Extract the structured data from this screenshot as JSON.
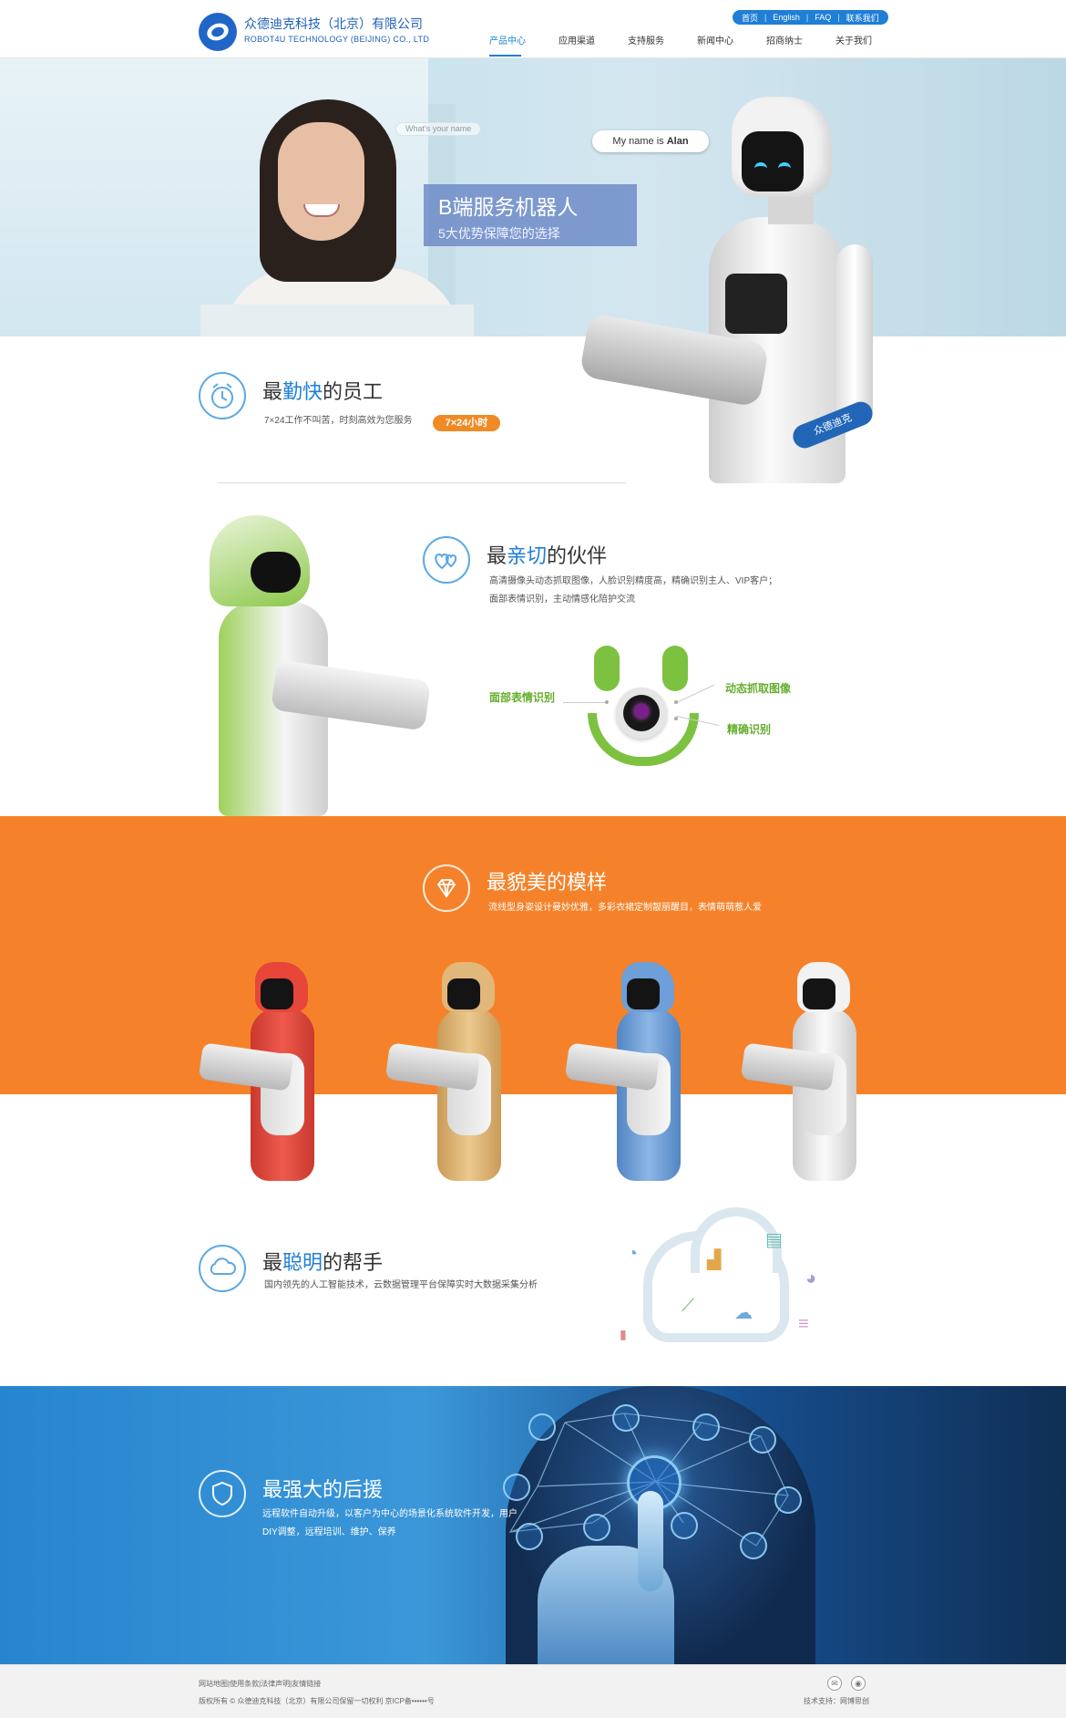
{
  "header": {
    "company_cn": "众德迪克科技（北京）有限公司",
    "company_en": "ROBOT4U TECHNOLOGY (BEIJING) CO., LTD",
    "top_links": [
      "首页",
      "English",
      "FAQ",
      "联系我们"
    ],
    "nav": [
      "产品中心",
      "应用渠道",
      "支持服务",
      "新闻中心",
      "招商纳士",
      "关于我们"
    ],
    "active_nav": "产品中心"
  },
  "hero": {
    "whats_name": "What's your name",
    "title": "B端服务机器人",
    "subtitle": "5大优势保障您的选择",
    "bubble_prefix": "My name is",
    "bubble_name": "Alan",
    "tray_logo": "众德迪克"
  },
  "features": {
    "f1": {
      "title_pre": "最",
      "title_hl": "勤快",
      "title_post": "的员工",
      "desc": "7×24工作不叫苦，时刻高效为您服务",
      "pill": "7×24小时"
    },
    "f2": {
      "title_pre": "最",
      "title_hl": "亲切",
      "title_post": "的伙伴",
      "desc_lines": [
        "高清摄像头动态抓取图像，人脸识别精度高，精确识别主人、VIP客户；",
        "面部表情识别，主动情感化陪护交流"
      ],
      "labels": {
        "left": "面部表情识别",
        "right_top": "动态抓取图像",
        "right_bottom": "精确识别"
      }
    },
    "f3": {
      "title": "最貌美的模样",
      "desc": "流线型身姿设计曼妙优雅，多彩衣裙定制靓丽醒目，表情萌萌惹人爱"
    },
    "f4": {
      "title_pre": "最",
      "title_hl": "聪明",
      "title_post": "的帮手",
      "desc": "国内领先的人工智能技术，云数据管理平台保障实时大数据采集分析"
    },
    "f5": {
      "title": "最强大的后援",
      "desc_lines": [
        "远程软件自动升级，以客户为中心的场景化系统软件开发，用户",
        "DIY调整，远程培训、维护、保养"
      ]
    }
  },
  "colors": {
    "brand_blue": "#1f7fd6",
    "orange": "#f5822a",
    "green": "#7dc141",
    "robot_variants": [
      "#e8463a",
      "#e2b77a",
      "#6e9fd8",
      "#f2f2f2"
    ]
  },
  "icons": {
    "f1": "alarm-clock-icon",
    "f2": "hearts-icon",
    "f3": "diamond-icon",
    "f4": "cloud-icon",
    "f5": "shield-icon",
    "footer": [
      "wechat-icon",
      "weibo-icon"
    ]
  },
  "footer": {
    "links": "网站地图|使用条款|法律声明|友情链接",
    "copyright": "版权所有 © 众德迪克科技（北京）有限公司保留一切权利   京ICP备••••••号",
    "tech": "技术支持：网博思创"
  }
}
